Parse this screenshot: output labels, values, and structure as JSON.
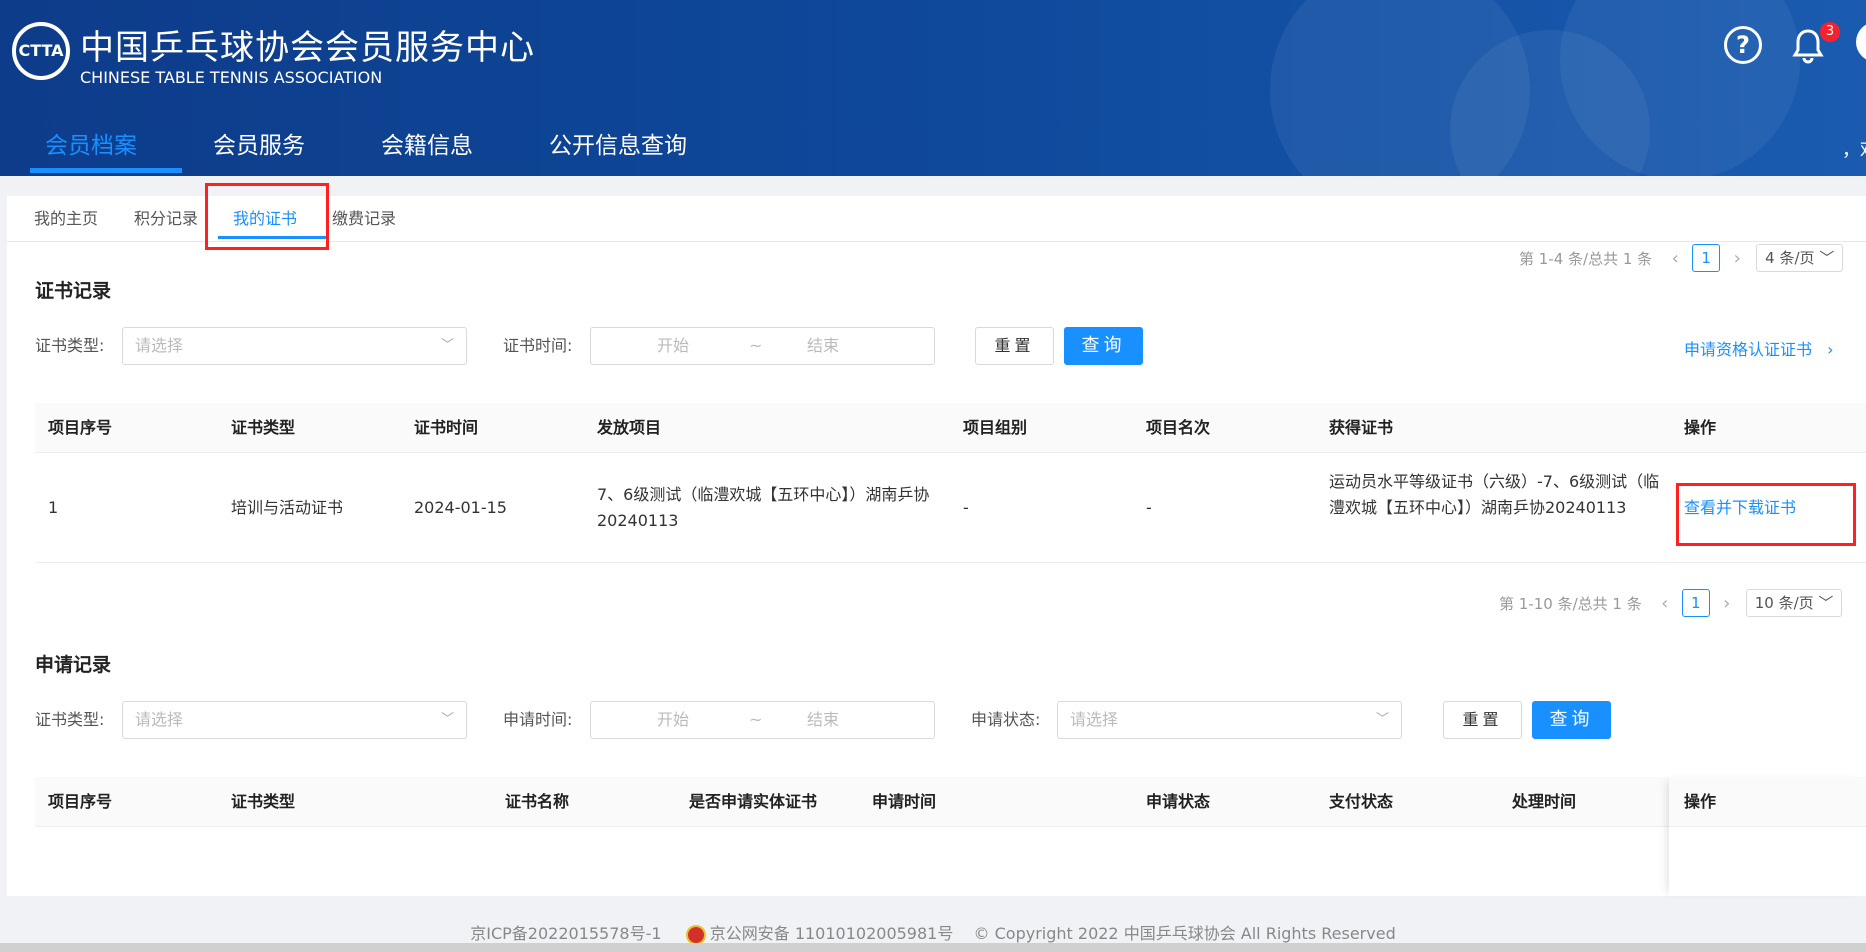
{
  "header": {
    "logo_text": "CTTA",
    "title_cn": "中国乒乓球协会会员服务中心",
    "title_en": "CHINESE TABLE TENNIS ASSOCIATION",
    "nav": [
      {
        "label": "会员档案",
        "active": true
      },
      {
        "label": "会员服务",
        "active": false
      },
      {
        "label": "会籍信息",
        "active": false
      },
      {
        "label": "公开信息查询",
        "active": false
      }
    ],
    "help_icon": "help-circle-icon",
    "bell_icon": "bell-icon",
    "notification_count": "3",
    "welcome_text": "，欢"
  },
  "tabs": [
    {
      "label": "我的主页",
      "active": false
    },
    {
      "label": "积分记录",
      "active": false
    },
    {
      "label": "我的证书",
      "active": true
    },
    {
      "label": "缴费记录",
      "active": false
    }
  ],
  "certificates": {
    "pager_top": {
      "summary": "第 1-4 条/总共 1 条",
      "page": "1",
      "page_size": "4 条/页"
    },
    "title": "证书记录",
    "filters": {
      "type_label": "证书类型:",
      "type_placeholder": "请选择",
      "time_label": "证书时间:",
      "start_placeholder": "开始",
      "range_sep": "~",
      "end_placeholder": "结束"
    },
    "reset_label": "重置",
    "query_label": "查询",
    "apply_link": "申请资格认证证书",
    "columns": [
      "项目序号",
      "证书类型",
      "证书时间",
      "发放项目",
      "项目组别",
      "项目名次",
      "获得证书",
      "操作"
    ],
    "rows": [
      {
        "no": "1",
        "type": "培训与活动证书",
        "time": "2024-01-15",
        "project": "7、6级测试（临澧欢城【五环中心】）湖南乒协20240113",
        "group": "-",
        "rank": "-",
        "cert": "运动员水平等级证书（六级）-7、6级测试（临澧欢城【五环中心】）湖南乒协20240113",
        "action": "查看并下载证书"
      }
    ],
    "pager_bottom": {
      "summary": "第 1-10 条/总共 1 条",
      "page": "1",
      "page_size": "10 条/页"
    }
  },
  "applications": {
    "title": "申请记录",
    "filters": {
      "type_label": "证书类型:",
      "type_placeholder": "请选择",
      "time_label": "申请时间:",
      "start_placeholder": "开始",
      "range_sep": "~",
      "end_placeholder": "结束",
      "status_label": "申请状态:",
      "status_placeholder": "请选择"
    },
    "reset_label": "重置",
    "query_label": "查询",
    "columns": [
      "项目序号",
      "证书类型",
      "证书名称",
      "是否申请实体证书",
      "申请时间",
      "申请状态",
      "支付状态",
      "处理时间",
      "操作"
    ]
  },
  "footer": {
    "icp": "京ICP备2022015578号-1",
    "police_icon": "police-badge-icon",
    "police": "京公网安备 11010102005981号",
    "copyright": "© Copyright 2022 中国乒乓球协会 All Rights Reserved"
  },
  "colors": {
    "brand_dark": "#0d3c8a",
    "accent": "#1890ff",
    "highlight": "#ff2020",
    "badge": "#f5222d"
  }
}
